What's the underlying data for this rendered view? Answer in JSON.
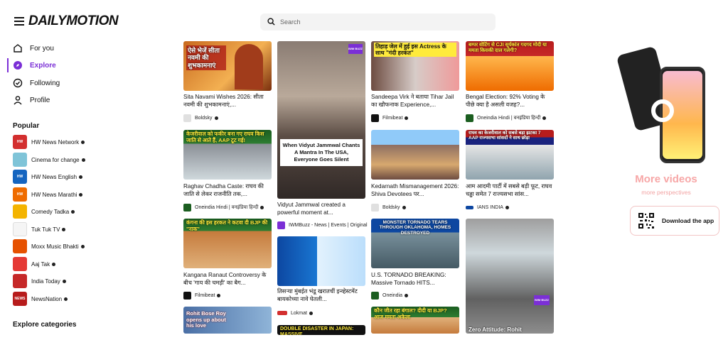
{
  "header": {
    "logo": "DAILYMOTION",
    "search_placeholder": "Search"
  },
  "nav": [
    {
      "label": "For you",
      "icon": "compass-icon"
    },
    {
      "label": "Explore",
      "icon": "explore-icon",
      "active": true
    },
    {
      "label": "Following",
      "icon": "check-circle-icon"
    },
    {
      "label": "Profile",
      "icon": "user-icon"
    }
  ],
  "popular": {
    "title": "Popular",
    "channels": [
      {
        "name": "HW News Network",
        "color": "#d32f2f",
        "short": "HW"
      },
      {
        "name": "Cinema for change",
        "color": "#7fc4d8",
        "short": ""
      },
      {
        "name": "HW News English",
        "color": "#1565c0",
        "short": "HW"
      },
      {
        "name": "HW News Marathi",
        "color": "#ef6c00",
        "short": "HW"
      },
      {
        "name": "Comedy Tadka",
        "color": "#f4b400",
        "short": ""
      },
      {
        "name": "Tuk Tuk TV",
        "color": "#f5f5f5",
        "short": ""
      },
      {
        "name": "Moxx Music Bhakti",
        "color": "#e65100",
        "short": ""
      },
      {
        "name": "Aaj Tak",
        "color": "#e53935",
        "short": ""
      },
      {
        "name": "India Today",
        "color": "#c62828",
        "short": ""
      },
      {
        "name": "NewsNation",
        "color": "#b71c1c",
        "short": "NEWS"
      }
    ]
  },
  "explore_categories": "Explore categories",
  "feed": {
    "col1": [
      {
        "overlay": "ऐसे भेजें सीता नवमी की शुभकामनाएं",
        "title": "Sita Navami Wishes 2026: सीता नवमी की शुभकामनाएं,...",
        "channel": "Boldsky"
      },
      {
        "overlay": "केजरीवाल को फकीर बना गए राघव किस जाति से आते हैं, AAP टूट गई!",
        "title": "Raghav Chadha Caste: राघव की जाति से लेकर राजनीति तक,...",
        "channel": "Oneindia Hindi | वनइंडिया हिन्दी"
      },
      {
        "overlay": "कंगना की इस हरकत ने कटवा दी BJP की \"नाक\"",
        "title": "Kangana Ranaut Controversy के बीच 'गाय की चमड़ी' का बैग...",
        "channel": "Filmibeat"
      },
      {
        "overlay": "Rohit Bose Roy opens up about his love",
        "title": "",
        "channel": ""
      }
    ],
    "col2": [
      {
        "overlay": "When Vidyut Jammwal Chants A Mantra In The USA, Everyone Goes Silent",
        "title": "Vidyut Jammwal created a powerful moment at...",
        "channel": "IWMBuzz - News | Events | Original"
      },
      {
        "overlay": "",
        "title": "तिसऱ्या मुंबईत भंडू खरातचीं इन्व्हेस्टमेंट बायकोच्या नावे घेतली...",
        "channel": "Lokmat"
      },
      {
        "overlay": "DOUBLE DISASTER IN JAPAN: MASSIVE",
        "title": "",
        "channel": ""
      }
    ],
    "col3": [
      {
        "overlay": "तिहाड़ जेल में हुई इस Actress के साथ \"गंदी हरकत\"",
        "title": "Sandeepa Virk ने बताया Tihar Jail का खौफनाक Experience,...",
        "channel": "Filmibeat"
      },
      {
        "overlay": "",
        "title": "Kedarnath Mismanagement 2026: Shiva Devotees पर...",
        "channel": "Boldsky"
      },
      {
        "overlay": "MONSTER TORNADO TEARS THROUGH OKLAHOMA, HOMES DESTROYED",
        "title": "U.S. TORNADO BREAKING: Massive Tornado HITS...",
        "channel": "Oneindia"
      },
      {
        "overlay": "कौन जीत रहा बंगाल? दीदी या BJP? आज ममता अकेला",
        "title": "",
        "channel": ""
      }
    ],
    "col4": [
      {
        "overlay": "बम्पर वोटिंग से CJI सूर्यकांत गदगद मोदी या ममता किसकी दाल गलेगी?",
        "title": "Bengal Election: 92% Voting के पीछे क्या है असली वजह?...",
        "channel": "Oneindia Hindi | वनइंडिया हिन्दी"
      },
      {
        "overlay": "राघव का केजरीवाल को सबसे बड़ा झटका 7 AAP राज्यसभा सांसदों ने साथ छोड़ा",
        "title": "आम आदमी पार्टी में सबसे बड़ी फूट, राघव चड्ढा समेत 7 राज्यसभा सांस...",
        "channel": "IANS INDIA"
      },
      {
        "overlay": "Zero Attitude: Rohit",
        "title": "",
        "channel": ""
      }
    ]
  },
  "promo": {
    "title": "More videos",
    "subtitle": "more perspectives",
    "button": "Download the app"
  },
  "colors": {
    "accent": "#7b2fd6",
    "promo_pink": "#f7a7a7"
  }
}
